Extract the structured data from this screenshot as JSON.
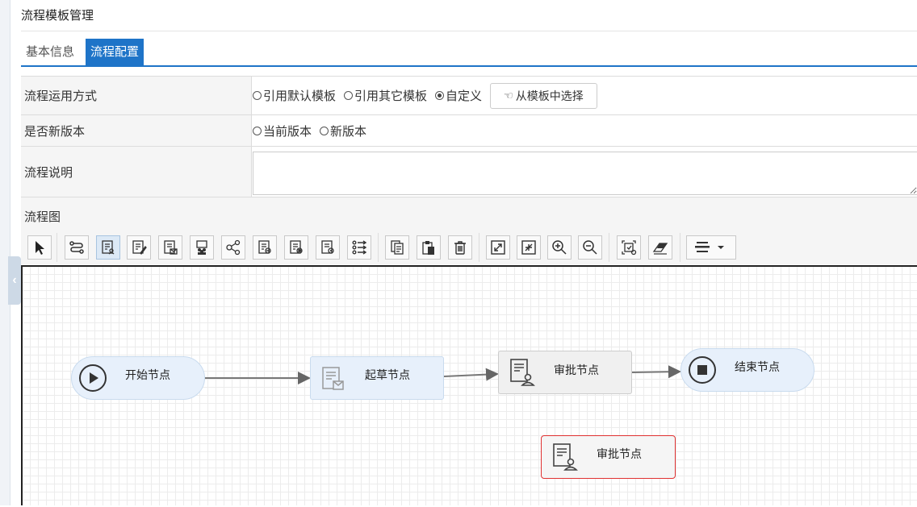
{
  "page": {
    "title": "流程模板管理"
  },
  "tabs": [
    {
      "label": "基本信息",
      "active": false
    },
    {
      "label": "流程配置",
      "active": true
    }
  ],
  "form": {
    "usage_mode": {
      "label": "流程运用方式",
      "options": [
        "引用默认模板",
        "引用其它模板",
        "自定义"
      ],
      "selected": "自定义",
      "button_label": "从模板中选择"
    },
    "new_version": {
      "label": "是否新版本",
      "options": [
        "当前版本",
        "新版本"
      ],
      "selected": ""
    },
    "description": {
      "label": "流程说明",
      "value": ""
    }
  },
  "diagram": {
    "header": "流程图",
    "toolbar_icons": [
      "pointer-icon",
      "connector-icon",
      "approve-node-icon",
      "edit-node-icon",
      "message-node-icon",
      "group-node-icon",
      "branch-node-icon",
      "handle-node-icon",
      "review-node-icon",
      "sign-node-icon",
      "list-icon",
      "copy-icon",
      "paste-icon",
      "delete-icon",
      "expand-icon",
      "shrink-icon",
      "zoom-in-icon",
      "zoom-out-icon",
      "screenshot-icon",
      "eraser-icon",
      "align-icon"
    ],
    "nodes": {
      "start": "开始节点",
      "draft": "起草节点",
      "approve1": "审批节点",
      "end": "结束节点",
      "approve2": "审批节点"
    },
    "colors": {
      "accent": "#1e74c8",
      "selected_border": "#e03131",
      "node_fill": "#e7f0fb"
    }
  }
}
